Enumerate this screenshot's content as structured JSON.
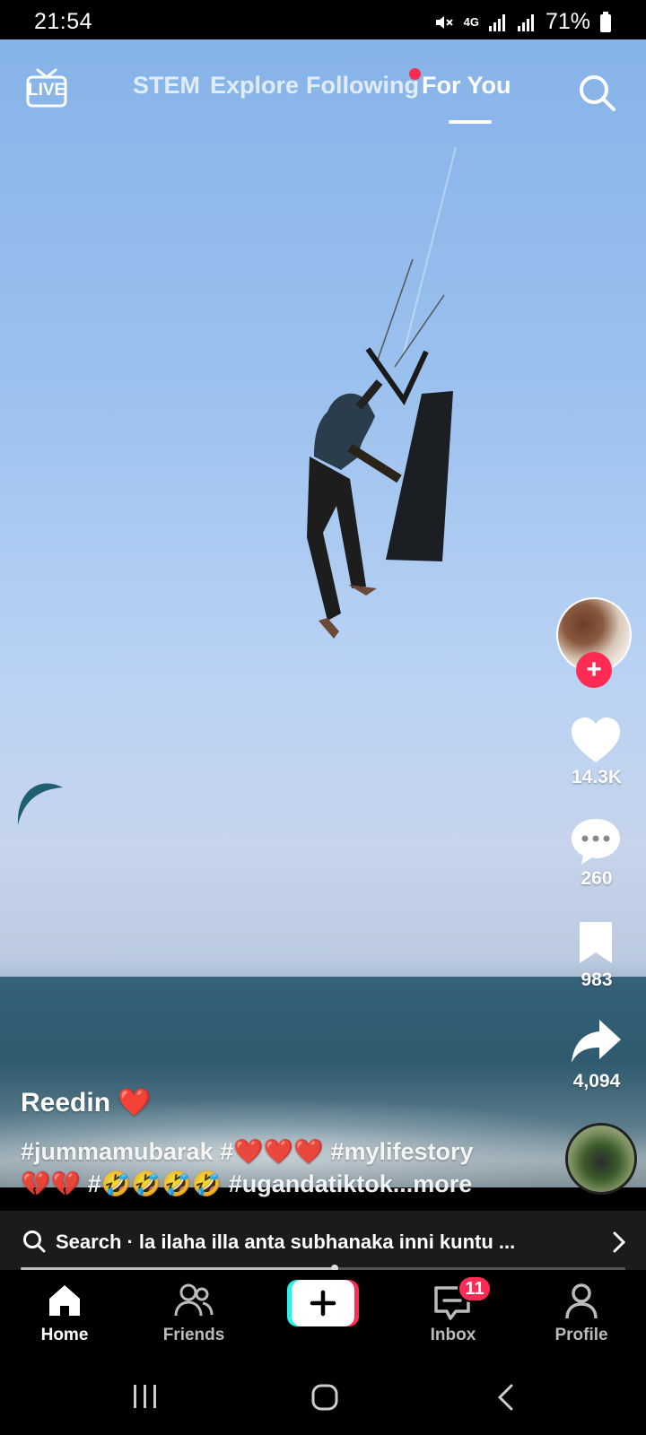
{
  "status_bar": {
    "time": "21:54",
    "network": "4G",
    "battery": "71%",
    "icons": [
      "mute-icon",
      "signal-icon",
      "signal-icon",
      "battery-icon"
    ]
  },
  "top_nav": {
    "live_label": "LIVE",
    "tabs": [
      {
        "label": "STEM",
        "active": false
      },
      {
        "label": "Explore",
        "active": false
      },
      {
        "label": "Following",
        "active": false,
        "has_dot": true
      },
      {
        "label": "For You",
        "active": true
      }
    ]
  },
  "video": {
    "username": "Reedin ❤️",
    "caption_line1": "#jummamubarak #❤️❤️❤️ #mylifestory",
    "caption_line2": "💔💔 #🤣🤣🤣🤣 #ugandatiktok",
    "caption_more": "...more"
  },
  "actions": {
    "likes": "14.3K",
    "comments": "260",
    "saves": "983",
    "shares": "4,094"
  },
  "search_bar": {
    "text": "Search · la ilaha illa anta subhanaka inni kuntu ...",
    "progress": 0.52
  },
  "tab_bar": {
    "home": "Home",
    "friends": "Friends",
    "inbox": "Inbox",
    "inbox_badge": "11",
    "profile": "Profile"
  },
  "colors": {
    "accent": "#fe2c55",
    "background": "#000000",
    "create_cyan": "#25f4ee",
    "create_red": "#fe2c55"
  }
}
